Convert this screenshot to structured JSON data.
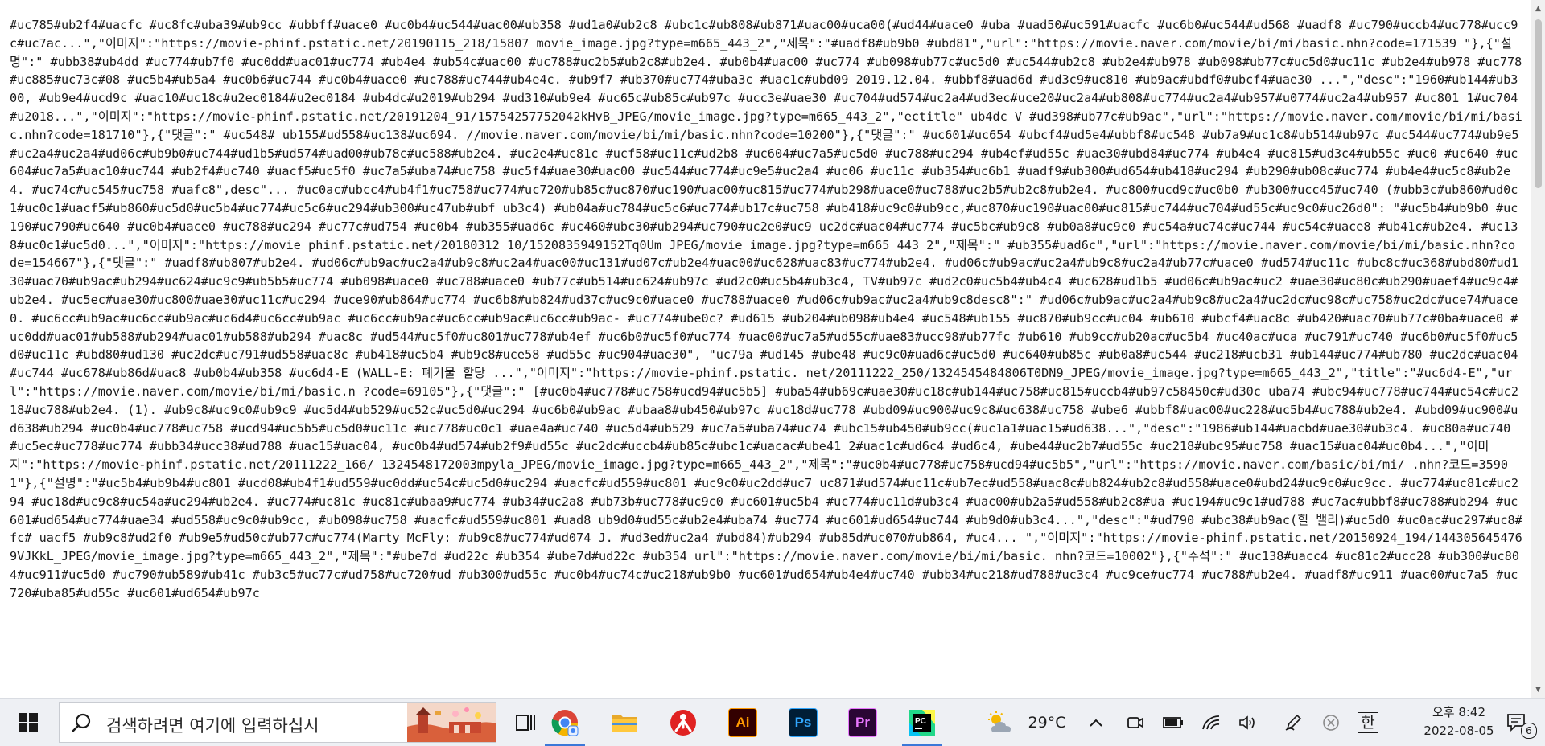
{
  "document": {
    "text": "#uc785#ub2f4#uacfc #uc8fc#uba39#ub9cc #ubbff#uace0 #uc0b4#uc544#uac00#ub358 #ud1a0#ub2c8 #ubc1c#ub808#ub871#uac00#uca00(#ud44#uace0 #uba #uad50#uc591#uacfc #uc6b0#uc544#ud568 #uadf8 #uc790#uccb4#uc778#ucc9c#uc7ac...\",\"이미지\":\"https://movie-phinf.pstatic.net/20190115_218/15807 movie_image.jpg?type=m665_443_2\",\"제목\":\"#uadf8#ub9b0 #ubd81\",\"url\":\"https://movie.naver.com/movie/bi/mi/basic.nhn?code=171539 \"},{\"설명\":\" #ubb38#ub4dd #uc774#ub7f0 #uc0dd#uac01#uc774 #ub4e4 #ub54c#uac00 #uc788#uc2b5#ub2c8#ub2e4. #ub0b4#uac00 #uc774 #ub098#ub77c#uc5d0 #uc544#ub2c8 #ub2e4#ub978 #ub098#ub77c#uc5d0#uc11c #ub2e4#ub978 #uc778#uc885#uc73c#08 #uc5b4#ub5a4 #uc0b6#uc744 #uc0b4#uace0 #uc788#uc744#ub4e4c. #ub9f7 #ub370#uc774#uba3c #uac1c#ubd09 2019.12.04. #ubbf8#uad6d #ud3c9#uc810 #ub9ac#ubdf0#ubcf4#uae30 ...\",\"desc\":\"1960#ub144#ub300, #ub9e4#ucd9c #uac10#uc18c#u2ec0184#u2ec0184 #ub4dc#u2019#ub294 #ud310#ub9e4 #uc65c#ub85c#ub97c #ucc3e#uae30 #uc704#ud574#uc2a4#ud3ec#uce20#uc2a4#ub808#uc774#uc2a4#ub957#u0774#uc2a4#ub957 #uc801 1#uc704 #u2018...\",\"이미지\":\"https://movie-phinf.pstatic.net/20191204_91/15754257752042kHvB_JPEG/movie_image.jpg?type=m665_443_2\",\"ectitle\" ub4dc V #ud398#ub77c#ub9ac\",\"url\":\"https://movie.naver.com/movie/bi/mi/basic.nhn?code=181710\"},{\"댓글\":\" #uc548# ub155#ud558#uc138#uc694. //movie.naver.com/movie/bi/mi/basic.nhn?code=10200\"},{\"댓글\":\" #uc601#uc654 #ubcf4#ud5e4#ubbf8#uc548 #ub7a9#uc1c8#ub514#ub97c #uc544#uc774#ub9e5#uc2a4#uc2a4#ud06c#ub9b0#uc744#ud1b5#ud574#uad00#ub78c#uc588#ub2e4. #uc2e4#uc81c #ucf58#uc11c#ud2b8 #uc604#uc7a5#uc5d0 #uc788#uc294 #ub4ef#ud55c #uae30#ubd84#uc774 #ub4e4 #uc815#ud3c4#ub55c #uc0 #uc640 #uc604#uc7a5#uac10#uc744 #ub2f4#uc740 #uacf5#uc5f0 #uc7a5#uba74#uc758 #uc5f4#uae30#uac00 #uc544#uc774#uc9e5#uc2a4 #uc06 #uc11c #ub354#uc6b1 #uadf9#ub300#ud654#ub418#uc294 #ub290#ub08c#uc774 #ub4e4#uc5c8#ub2e4. #uc74c#uc545#uc758 #uafc8\",desc\"... #uc0ac#ubcc4#ub4f1#uc758#uc774#uc720#ub85c#uc870#uc190#uac00#uc815#uc774#ub298#uace0#uc788#uc2b5#ub2c8#ub2e4. #uc800#ucd9c#uc0b0 #ub300#ucc45#uc740 (#ubb3c#ub860#ud0c1#uc0c1#uacf5#ub860#uc5d0#uc5b4#uc774#uc5c6#uc294#ub300#uc47ub#ubf ub3c4) #ub04a#uc784#uc5c6#uc774#ub17c#uc758 #ub418#uc9c0#ub9cc,#uc870#uc190#uac00#uc815#uc744#uc704#ud55c#uc9c0#uc26d0\": \"#uc5b4#ub9b0 #uc190#uc790#uc640 #uc0b4#uace0 #uc788#uc294 #uc77c#ud754 #uc0b4 #ub355#uad6c #uc460#ubc30#ub294#uc790#uc2e0#uc9 uc2dc#uac04#uc774 #uc5bc#ub9c8 #ub0a8#uc9c0 #uc54a#uc74c#uc744 #uc54c#uace8 #ub41c#ub2e4. #uc138#uc0c1#uc5d0...\",\"이미지\":\"https://movie phinf.pstatic.net/20180312_10/1520835949152Tq0Um_JPEG/movie_image.jpg?type=m665_443_2\",\"제목\":\" #ub355#uad6c\",\"url\":\"https://movie.naver.com/movie/bi/mi/basic.nhn?code=154667\"},{\"댓글\":\" #uadf8#ub807#ub2e4. #ud06c#ub9ac#uc2a4#ub9c8#uc2a4#uac00#uc131#ud07c#ub2e4#uac00#uc628#uac83#uc774#ub2e4. #ud06c#ub9ac#uc2a4#ub9c8#uc2a4#ub77c#uace0 #ud574#uc11c #ubc8c#uc368#ubd80#ud130#uac70#ub9ac#ub294#uc624#uc9c9#ub5b5#uc774 #ub098#uace0 #uc788#uace0 #ub77c#ub514#uc624#ub97c #ud2c0#uc5b4#ub3c4, TV#ub97c #ud2c0#uc5b4#ub4c4 #uc628#ud1b5 #ud06c#ub9ac#uc2 #uae30#uc80c#ub290#uaef4#uc9c4#ub2e4. #uc5ec#uae30#uc800#uae30#uc11c#uc294 #uce90#ub864#uc774 #uc6b8#ub824#ud37c#uc9c0#uace0 #uc788#uace0 #ud06c#ub9ac#uc2a4#ub9c8desc8\":\" #ud06c#ub9ac#uc2a4#ub9c8#uc2a4#uc2dc#uc98c#uc758#uc2dc#uce74#uace0. #uc6cc#ub9ac#uc6cc#ub9ac#uc6d4#uc6cc#ub9ac #uc6cc#ub9ac#uc6cc#ub9ac#uc6cc#ub9ac- #uc774#ube0c? #ud615 #ub204#ub098#ub4e4 #uc548#ub155 #uc870#ub9cc#uc04 #ub610 #ubcf4#uac8c #ub420#uac70#ub77c#0ba#uace0 #uc0dd#uac01#ub588#ub294#uac01#ub588#ub294 #uac8c #ud544#uc5f0#uc801#uc778#ub4ef #uc6b0#uc5f0#uc774 #uac00#uc7a5#ud55c#uae83#ucc98#ub77fc #ub610 #ub9cc#ub20ac#uc5b4 #uc40ac#uca #uc791#uc740 #uc6b0#uc5f0#uc5d0#uc11c #ubd80#ud130 #uc2dc#uc791#ud558#uac8c #ub418#uc5b4 #ub9c8#uce58 #ud55c #uc904#uae30\", \"uc79a #ud145 #ube48 #uc9c0#uad6c#uc5d0 #uc640#ub85c #ub0a8#uc544 #uc218#ucb31 #ub144#uc774#ub780 #uc2dc#uac04#uc744 #uc678#ub86d#uac8 #ub0b4#ub358 #uc6d4-E (WALL-E: 폐기물 할당 ...\",\"이미지\":\"https://movie-phinf.pstatic. net/20111222_250/1324545484806T0DN9_JPEG/movie_image.jpg?type=m665_443_2\",\"title\":\"#uc6d4-E\",\"url\":\"https://movie.naver.com/movie/bi/mi/basic.n ?code=69105\"},{\"댓글\":\" [#uc0b4#uc778#uc758#ucd94#uc5b5] #uba54#ub69c#uae30#uc18c#ub144#uc758#uc815#uccb4#ub97c58450c#ud30c uba74 #ubc94#uc778#uc744#uc54c#uc218#uc788#ub2e4. (1). #ub9c8#uc9c0#ub9c9 #uc5d4#ub529#uc52c#uc5d0#uc294 #uc6b0#ub9ac #ubaa8#ub450#ub97c #uc18d#uc778 #ubd09#uc900#uc9c8#uc638#uc758 #ube6 #ubbf8#uac00#uc228#uc5b4#uc788#ub2e4. #ubd09#uc900#ud638#ub294 #uc0b4#uc778#uc758 #ucd94#uc5b5#uc5d0#uc11c #uc778#uc0c1 #uae4a#uc740 #uc5d4#ub529 #uc7a5#uba74#uc74 #ubc15#ub450#ub9cc(#uc1a1#uac15#ud638...\",\"desc\":\"1986#ub144#uacbd#uae30#ub3c4. #uc80a#uc740 #uc5ec#uc778#uc774 #ubb34#ucc38#ud788 #uac15#uac04, #uc0b4#ud574#ub2f9#ud55c #uc2dc#uccb4#ub85c#ubc1c#uacac#ube41 2#uac1c#ud6c4 #ud6c4, #ube44#uc2b7#ud55c #uc218#ubc95#uc758 #uac15#uac04#uc0b4...\",\"이미지\":\"https://movie-phinf.pstatic.net/20111222_166/ 1324548172003mpyla_JPEG/movie_image.jpg?type=m665_443_2\",\"제목\":\"#uc0b4#uc778#uc758#ucd94#uc5b5\",\"url\":\"https://movie.naver.com/basic/bi/mi/ .nhn?코드=35901\"},{\"설명\":\"#uc5b4#ub9b4#uc801 #ucd08#ub4f1#ud559#uc0dd#uc54c#uc5d0#uc294 #uacfc#ud559#uc801 #uc9c0#uc2dd#uc7 uc871#ud574#uc11c#ub7ec#ud558#uac8c#ub824#ub2c8#ud558#uace0#ubd24#uc9c0#uc9cc. #uc774#uc81c#uc294 #uc18d#uc9c8#uc54a#uc294#ub2e4. #uc774#uc81c #uc81c#ubaa9#uc774 #ub34#uc2a8 #ub73b#uc778#uc9c0 #uc601#uc5b4 #uc774#uc11d#ub3c4 #uac00#ub2a5#ud558#ub2c8#ua #uc194#uc9c1#ud788 #uc7ac#ubbf8#uc788#ub294 #uc601#ud654#uc774#uae34 #ud558#uc9c0#ub9cc, #ub098#uc758 #uacfc#ud559#uc801 #uad8 ub9d0#ud55c#ub2e4#uba74 #uc774 #uc601#ud654#uc744 #ub9d0#ub3c4...\",\"desc\":\"#ud790 #ubc38#ub9ac(힐 밸리)#uc5d0 #uc0ac#uc297#uc8#fc# uacf5 #ub9c8#ud2f0 #ub9e5#ud50c#ub77c#uc774(Marty McFly: #ub9c8#uc774#ud074 J. #ud3ed#uc2a4 #ubd84)#ub294 #ub85d#uc070#ub864, #uc4... \",\"이미지\":\"https://movie-phinf.pstatic.net/20150924_194/1443056454769VJKkL_JPEG/movie_image.jpg?type=m665_443_2\",\"제목\":\"#ube7d #ud22c #ub354 #ube7d#ud22c #ub354 url\":\"https://movie.naver.com/movie/bi/mi/basic. nhn?코드=10002\"},{\"주석\":\" #uc138#uacc4 #uc81c2#ucc28 #ub300#uc804#uc911#uc5d0 #uc790#ub589#ub41c #ub3c5#uc77c#ud758#uc720#ud #ub300#ud55c #uc0b4#uc74c#uc218#ub9b0 #uc601#ud654#ub4e4#uc740 #ubb34#uc218#ud788#uc3c4 #uc9ce#uc774 #uc788#ub2e4. #uadf8#uc911 #uac00#uc7a5 #uc720#uba85#ud55c #uc601#ud654#ub97c"
  },
  "taskbar": {
    "search_placeholder": "검색하려면 여기에 입력하십시",
    "weather_temp": "29°C",
    "ime_label": "한",
    "clock_time": "오후 8:42",
    "clock_date": "2022-08-05",
    "notification_count": "6",
    "apps": [
      {
        "name": "Google Chrome",
        "icon": "chrome-icon"
      },
      {
        "name": "File Explorer",
        "icon": "folder-icon"
      },
      {
        "name": "App",
        "icon": "red-figure-icon"
      },
      {
        "name": "Illustrator",
        "label": "Ai",
        "icon": "illustrator-icon"
      },
      {
        "name": "Photoshop",
        "label": "Ps",
        "icon": "photoshop-icon"
      },
      {
        "name": "Premiere Pro",
        "label": "Pr",
        "icon": "premiere-icon"
      },
      {
        "name": "PyCharm",
        "label": "PC",
        "icon": "pycharm-icon"
      }
    ],
    "colors": {
      "illustrator_bg": "#330000",
      "illustrator_fg": "#ff9a00",
      "photoshop_bg": "#001e36",
      "photoshop_fg": "#31a8ff",
      "premiere_bg": "#2a0634",
      "premiere_fg": "#ea77ff",
      "active_indicator": "#3b78d8"
    }
  }
}
